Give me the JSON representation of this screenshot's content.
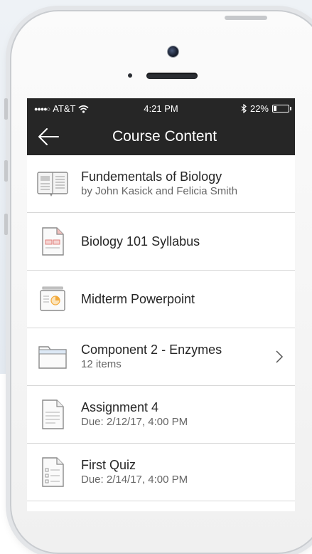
{
  "status_bar": {
    "signal": "●●●●○",
    "carrier": "AT&T",
    "time": "4:21 PM",
    "battery": "22%",
    "battery_level": 0.22
  },
  "header": {
    "title": "Course Content"
  },
  "items": [
    {
      "title": "Fundementals of Biology",
      "subtitle": "by John Kasick and Felicia Smith",
      "icon": "book-icon"
    },
    {
      "title": "Biology 101 Syllabus",
      "subtitle": "",
      "icon": "document-icon"
    },
    {
      "title": "Midterm Powerpoint",
      "subtitle": "",
      "icon": "presentation-icon"
    },
    {
      "title": "Component 2 - Enzymes",
      "subtitle": "12 items",
      "icon": "folder-icon"
    },
    {
      "title": "Assignment 4",
      "subtitle": "Due: 2/12/17, 4:00 PM",
      "icon": "assignment-icon"
    },
    {
      "title": "First Quiz",
      "subtitle": "Due: 2/14/17, 4:00 PM",
      "icon": "quiz-icon"
    }
  ],
  "colors": {
    "nav_bg": "#262626",
    "accent_pink": "#e0827d",
    "accent_orange": "#f2a93b",
    "folder_blue": "#dce8f5"
  }
}
